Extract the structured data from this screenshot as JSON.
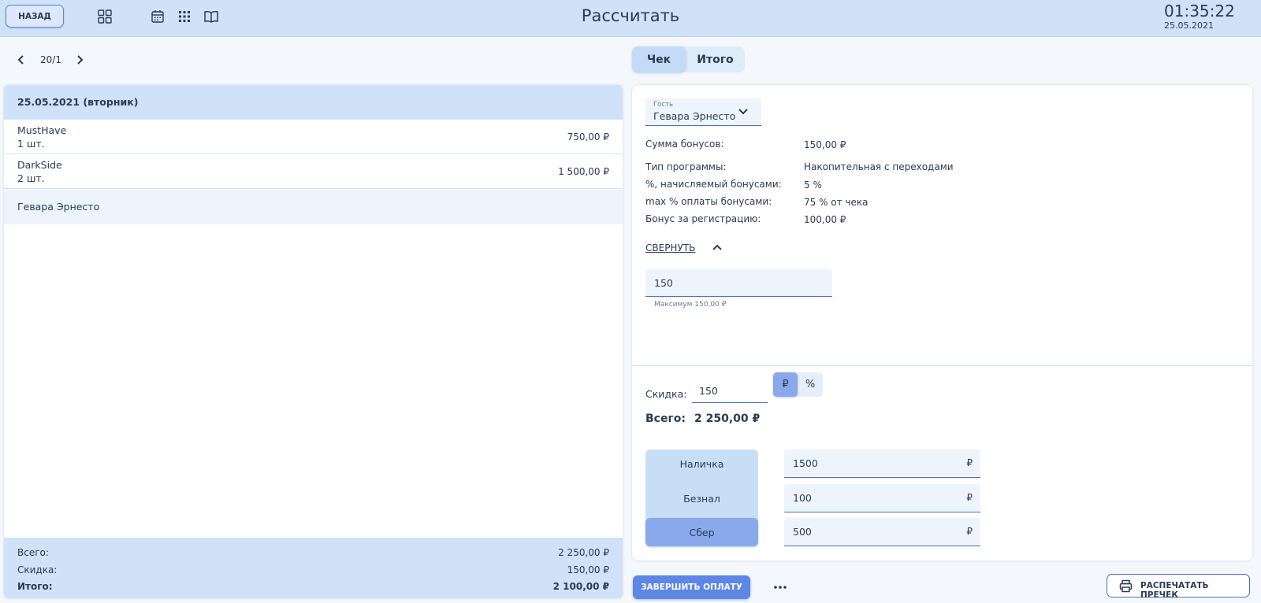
{
  "header": {
    "back_label": "НАЗАД",
    "title": "Рассчитать",
    "time": "01:35:22",
    "date": "25.05.2021",
    "icons": [
      "grid-icon",
      "calendar-icon",
      "dots-grid-icon",
      "book-icon"
    ]
  },
  "table_nav": {
    "number": "20/1"
  },
  "tabs": [
    {
      "label": "Чек",
      "active": true
    },
    {
      "label": "Итого",
      "active": false
    }
  ],
  "order": {
    "date": "25.05.2021 (вторник)",
    "items": [
      {
        "name": "MustHave",
        "qty": "1 шт.",
        "price": "750,00 ₽"
      },
      {
        "name": "DarkSide",
        "qty": "2 шт.",
        "price": "1 500,00 ₽"
      }
    ],
    "guest": "Гевара Эрнесто",
    "totals": {
      "total_label": "Всего:",
      "total_value": "2 250,00 ₽",
      "discount_label": "Скидка:",
      "discount_value": "150,00 ₽",
      "final_label": "Итого:",
      "final_value": "2 100,00 ₽"
    }
  },
  "check": {
    "guest_select": {
      "label": "Гость",
      "value": "Гевара Эрнесто"
    },
    "bonus_info": [
      {
        "label": "Сумма бонусов:",
        "value": "150,00 ₽"
      },
      {
        "label": "Тип программы:",
        "value": "Накопительная с переходами"
      },
      {
        "label": "%, начисляемый бонусами:",
        "value": "5 %"
      },
      {
        "label": "max % оплаты бонусами:",
        "value": "75 % от чека"
      },
      {
        "label": "Бонус за регистрацию:",
        "value": "100,00 ₽"
      }
    ],
    "collapse_label": "СВЕРНУТЬ",
    "bonus_input": {
      "value": "150",
      "hint": "Максимум 150,00 ₽"
    },
    "discount": {
      "label": "Скидка:",
      "value": "150",
      "units": [
        {
          "label": "₽",
          "active": true
        },
        {
          "label": "%",
          "active": false
        }
      ]
    },
    "total": {
      "label": "Всего:",
      "value": "2 250,00 ₽"
    },
    "payments": [
      {
        "method": "Наличка",
        "amount": "1500",
        "currency": "₽",
        "active": false
      },
      {
        "method": "Безнал",
        "amount": "100",
        "currency": "₽",
        "active": false
      },
      {
        "method": "Сбер",
        "amount": "500",
        "currency": "₽",
        "active": true
      }
    ]
  },
  "actions": {
    "finish_label": "ЗАВЕРШИТЬ ОПЛАТУ",
    "print_label": "РАСПЕЧАТАТЬ ПРЕЧЕК"
  },
  "colors": {
    "header_bg": "#cfe2f8",
    "accent": "#5e86e6",
    "active_toggle": "#8aa8ec",
    "text": "#2b3a55"
  }
}
